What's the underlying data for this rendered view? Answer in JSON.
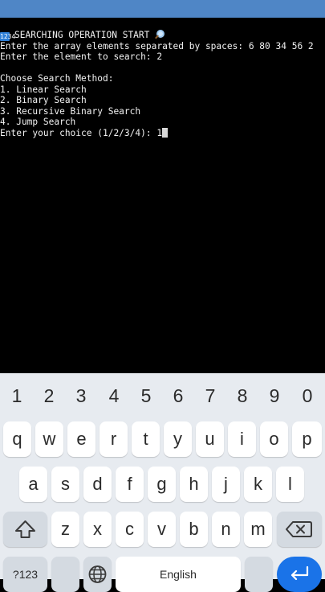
{
  "terminal": {
    "lines": [
      "SEARCHING OPERATION START",
      "Enter the array elements separated by spaces: 6 80 34 56 2",
      "Enter the element to search: 2",
      "",
      "Choose Search Method:",
      "1. Linear Search",
      "2. Binary Search",
      "3. Recursive Binary Search",
      "4. Jump Search",
      "Enter your choice (1/2/3/4): 1"
    ],
    "title_emoji": "1234"
  },
  "keyboard": {
    "number_row": [
      "1",
      "2",
      "3",
      "4",
      "5",
      "6",
      "7",
      "8",
      "9",
      "0"
    ],
    "row1": [
      "q",
      "w",
      "e",
      "r",
      "t",
      "y",
      "u",
      "i",
      "o",
      "p"
    ],
    "row2": [
      "a",
      "s",
      "d",
      "f",
      "g",
      "h",
      "j",
      "k",
      "l"
    ],
    "row3": [
      "z",
      "x",
      "c",
      "v",
      "b",
      "n",
      "m"
    ],
    "symbols_label": "?123",
    "space_label": "English"
  },
  "colors": {
    "status_bar": "#4f86c6",
    "terminal_bg": "#000000",
    "keyboard_bg": "#e7ebf0",
    "enter_key": "#1a73e8"
  }
}
